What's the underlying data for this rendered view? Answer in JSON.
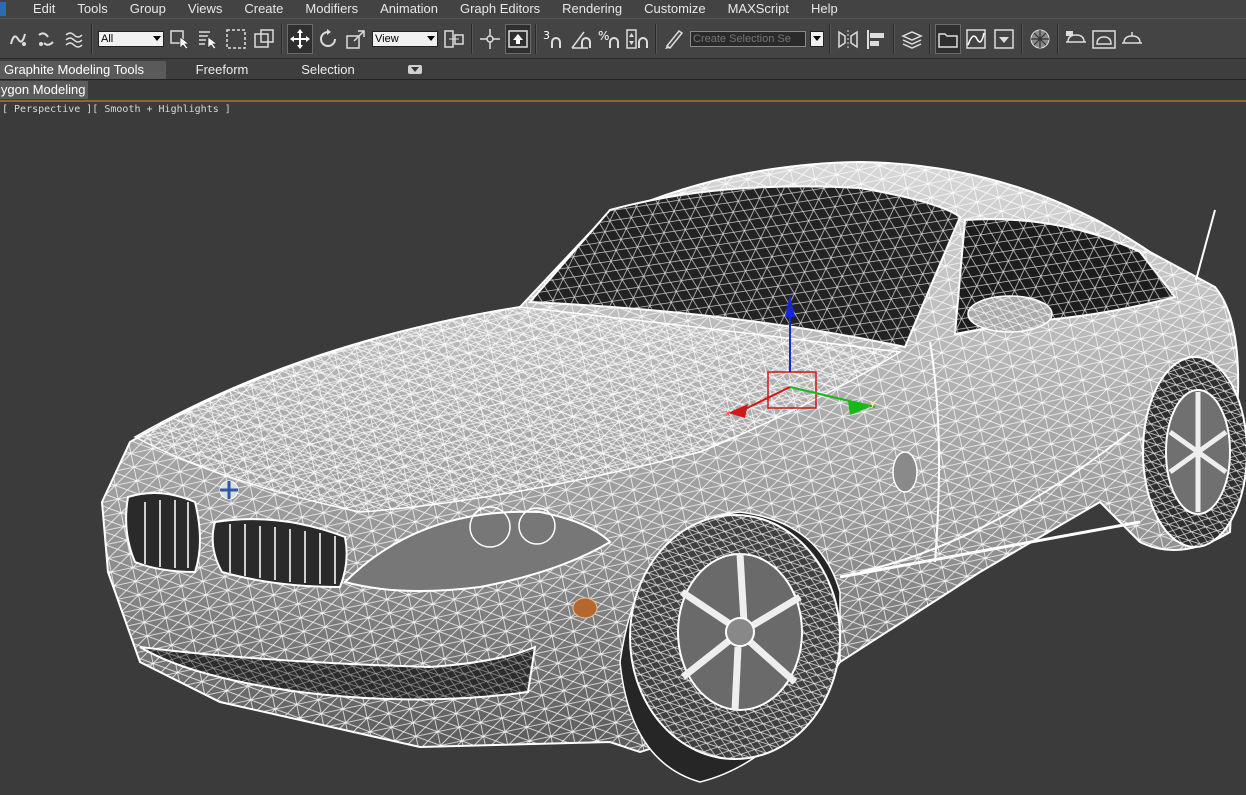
{
  "menu": [
    "Edit",
    "Tools",
    "Group",
    "Views",
    "Create",
    "Modifiers",
    "Animation",
    "Graph Editors",
    "Rendering",
    "Customize",
    "MAXScript",
    "Help"
  ],
  "toolbar": {
    "filter_select": "All",
    "reference_coord_select": "View",
    "selection_set_placeholder": "Create Selection Se",
    "snap_label": "3",
    "angle_snap_label": "%"
  },
  "ribbon": {
    "tabs": [
      "Graphite Modeling Tools",
      "Freeform",
      "Selection"
    ],
    "active_tab": "Graphite Modeling Tools",
    "panel": "lygon Modeling"
  },
  "viewport": {
    "label": "[ Perspective ][ Smooth + Highlights ]",
    "background": "#3b3b3b",
    "gizmo_colors": {
      "x": "#d01818",
      "y": "#18b818",
      "z": "#1828d0"
    }
  },
  "icons": [
    "link-icon",
    "unlink-icon",
    "bind-spacewarp-icon",
    "select-object-icon",
    "select-by-name-icon",
    "rect-selection-icon",
    "window-crossing-icon",
    "select-move-icon",
    "select-rotate-icon",
    "select-scale-icon",
    "pivot-icon",
    "manipulate-icon",
    "keyboard-shortcut-icon",
    "snap-toggle-icon",
    "angle-snap-icon",
    "percent-snap-icon",
    "spinner-snap-icon",
    "edit-named-selection-icon",
    "mirror-icon",
    "align-icon",
    "layer-manager-icon",
    "scene-explorer-icon",
    "curve-editor-icon",
    "schematic-view-icon",
    "material-editor-icon",
    "render-setup-icon",
    "rendered-frame-icon",
    "render-production-icon"
  ]
}
